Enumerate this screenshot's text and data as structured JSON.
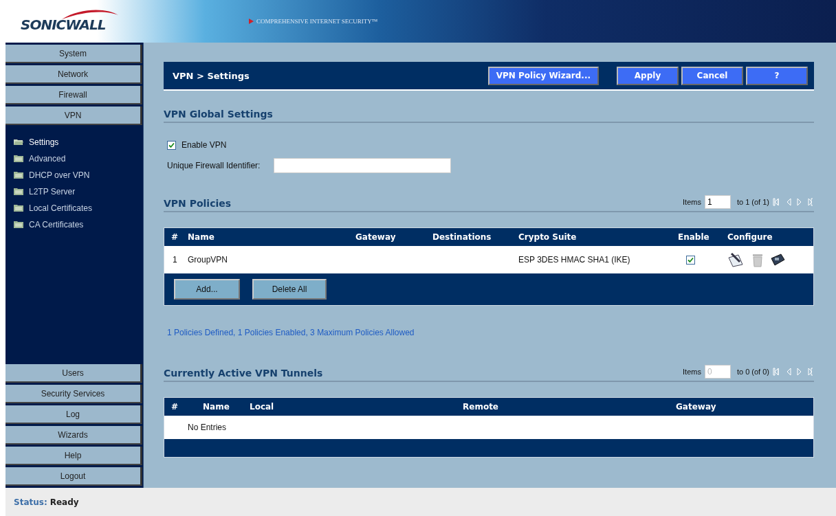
{
  "header": {
    "logo": "SONICWALL",
    "tagline": "COMPREHENSIVE INTERNET SECURITY™"
  },
  "sidebar": {
    "top_items": [
      "System",
      "Network",
      "Firewall",
      "VPN"
    ],
    "sub_items": [
      {
        "label": "Settings",
        "selected": true
      },
      {
        "label": "Advanced",
        "selected": false
      },
      {
        "label": "DHCP over VPN",
        "selected": false
      },
      {
        "label": "L2TP Server",
        "selected": false
      },
      {
        "label": "Local Certificates",
        "selected": false
      },
      {
        "label": "CA Certificates",
        "selected": false
      }
    ],
    "bottom_items": [
      "Users",
      "Security Services",
      "Log",
      "Wizards",
      "Help",
      "Logout"
    ]
  },
  "title_bar": {
    "title": "VPN > Settings",
    "buttons": [
      "VPN Policy Wizard...",
      "Apply",
      "Cancel",
      "?"
    ]
  },
  "global_settings": {
    "heading": "VPN Global Settings",
    "enable_vpn": {
      "label": "Enable VPN",
      "checked": true
    },
    "identifier": {
      "label": "Unique Firewall Identifier:"
    }
  },
  "policies": {
    "heading": "VPN Policies",
    "pager": {
      "label": "Items",
      "value": "1",
      "disabled": false,
      "range": "to 1 (of 1)"
    },
    "columns": [
      "#",
      "Name",
      "Gateway",
      "Destinations",
      "Crypto Suite",
      "Enable",
      "Configure"
    ],
    "rows": [
      {
        "number": "1",
        "name": "GroupVPN",
        "crypto_suite": "ESP 3DES HMAC SHA1 (IKE)",
        "enabled": true
      }
    ],
    "buttons": [
      "Add...",
      "Delete All"
    ],
    "summary": "1 Policies Defined, 1 Policies Enabled, 3 Maximum Policies Allowed"
  },
  "tunnels": {
    "heading": "Currently Active VPN Tunnels",
    "pager": {
      "label": "Items",
      "value": "0",
      "disabled": true,
      "range": "to 0 (of 0)"
    },
    "columns": [
      "#",
      "Name",
      "Local",
      "Remote",
      "Gateway"
    ],
    "empty_text": "No Entries"
  },
  "status_bar": {
    "label": "Status:",
    "value": "Ready"
  }
}
